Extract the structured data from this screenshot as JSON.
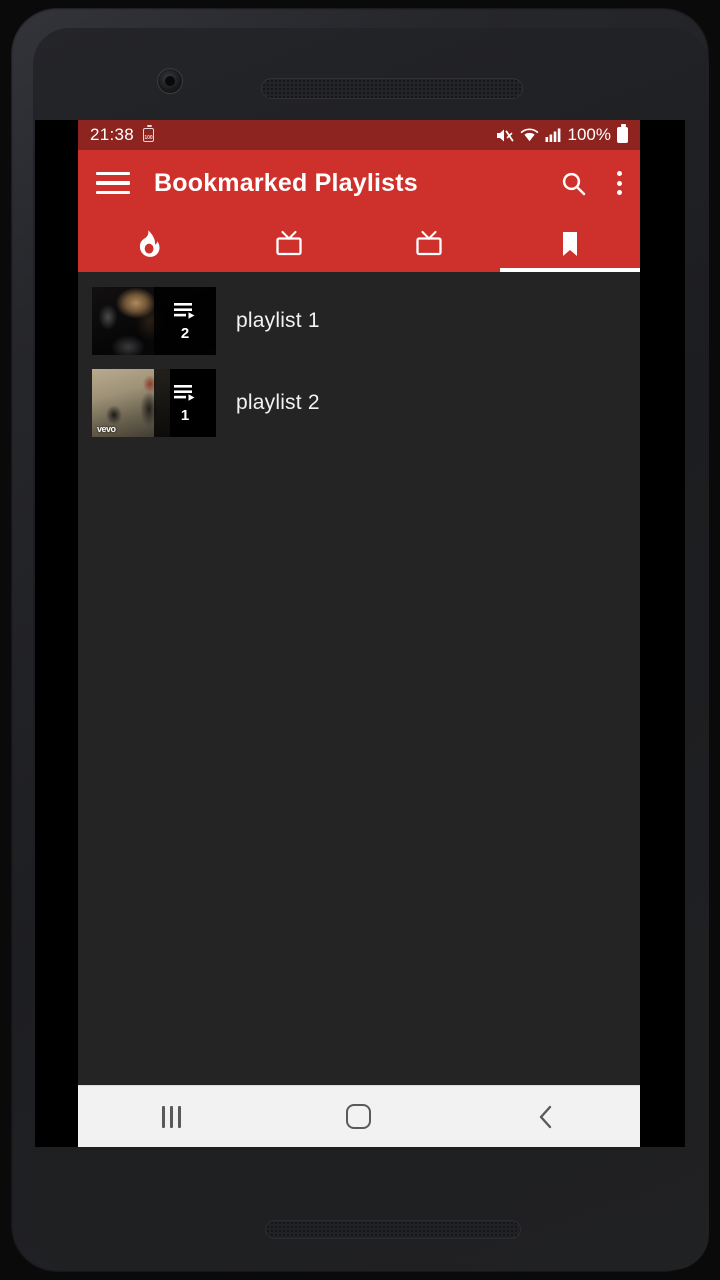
{
  "device": {
    "type": "android-phone",
    "front_camera": "camera-icon",
    "earpiece": "speaker-grille"
  },
  "status_bar": {
    "time": "21:38",
    "left_icons": [
      "battery-saver-icon"
    ],
    "right_icons": [
      "mute-icon",
      "wifi-icon",
      "signal-bars-icon"
    ],
    "battery_percent": "100%",
    "battery_icon": "battery-full-icon",
    "background_color": "#8e2420"
  },
  "app_bar": {
    "title": "Bookmarked Playlists",
    "menu_icon": "hamburger-menu-icon",
    "search_icon": "search-icon",
    "overflow_icon": "overflow-menu-icon",
    "background_color": "#CE312B",
    "text_color": "#ffffff"
  },
  "tabs": {
    "selected_index": 3,
    "indicator_color": "#ffffff",
    "items": [
      {
        "name": "trending",
        "icon": "flame-icon",
        "label": "Trending",
        "selected": false
      },
      {
        "name": "subscriptions",
        "icon": "tv-icon",
        "label": "Subscriptions",
        "selected": false
      },
      {
        "name": "channels",
        "icon": "tv-icon",
        "label": "Channels",
        "selected": false
      },
      {
        "name": "bookmarks",
        "icon": "bookmark-icon",
        "label": "Bookmarks",
        "selected": true
      }
    ]
  },
  "playlists": {
    "background_color": "#242424",
    "items": [
      {
        "title": "playlist 1",
        "count": "2",
        "badge_icon": "playlist-play-icon",
        "watermark": ""
      },
      {
        "title": "playlist 2",
        "count": "1",
        "badge_icon": "playlist-play-icon",
        "watermark": "vevo"
      }
    ]
  },
  "nav_bar": {
    "background_color": "#f2f2f2",
    "buttons": [
      {
        "name": "recents",
        "icon": "recents-icon",
        "label": "Recents"
      },
      {
        "name": "home",
        "icon": "home-icon",
        "label": "Home"
      },
      {
        "name": "back",
        "icon": "back-chevron-icon",
        "label": "Back"
      }
    ]
  }
}
